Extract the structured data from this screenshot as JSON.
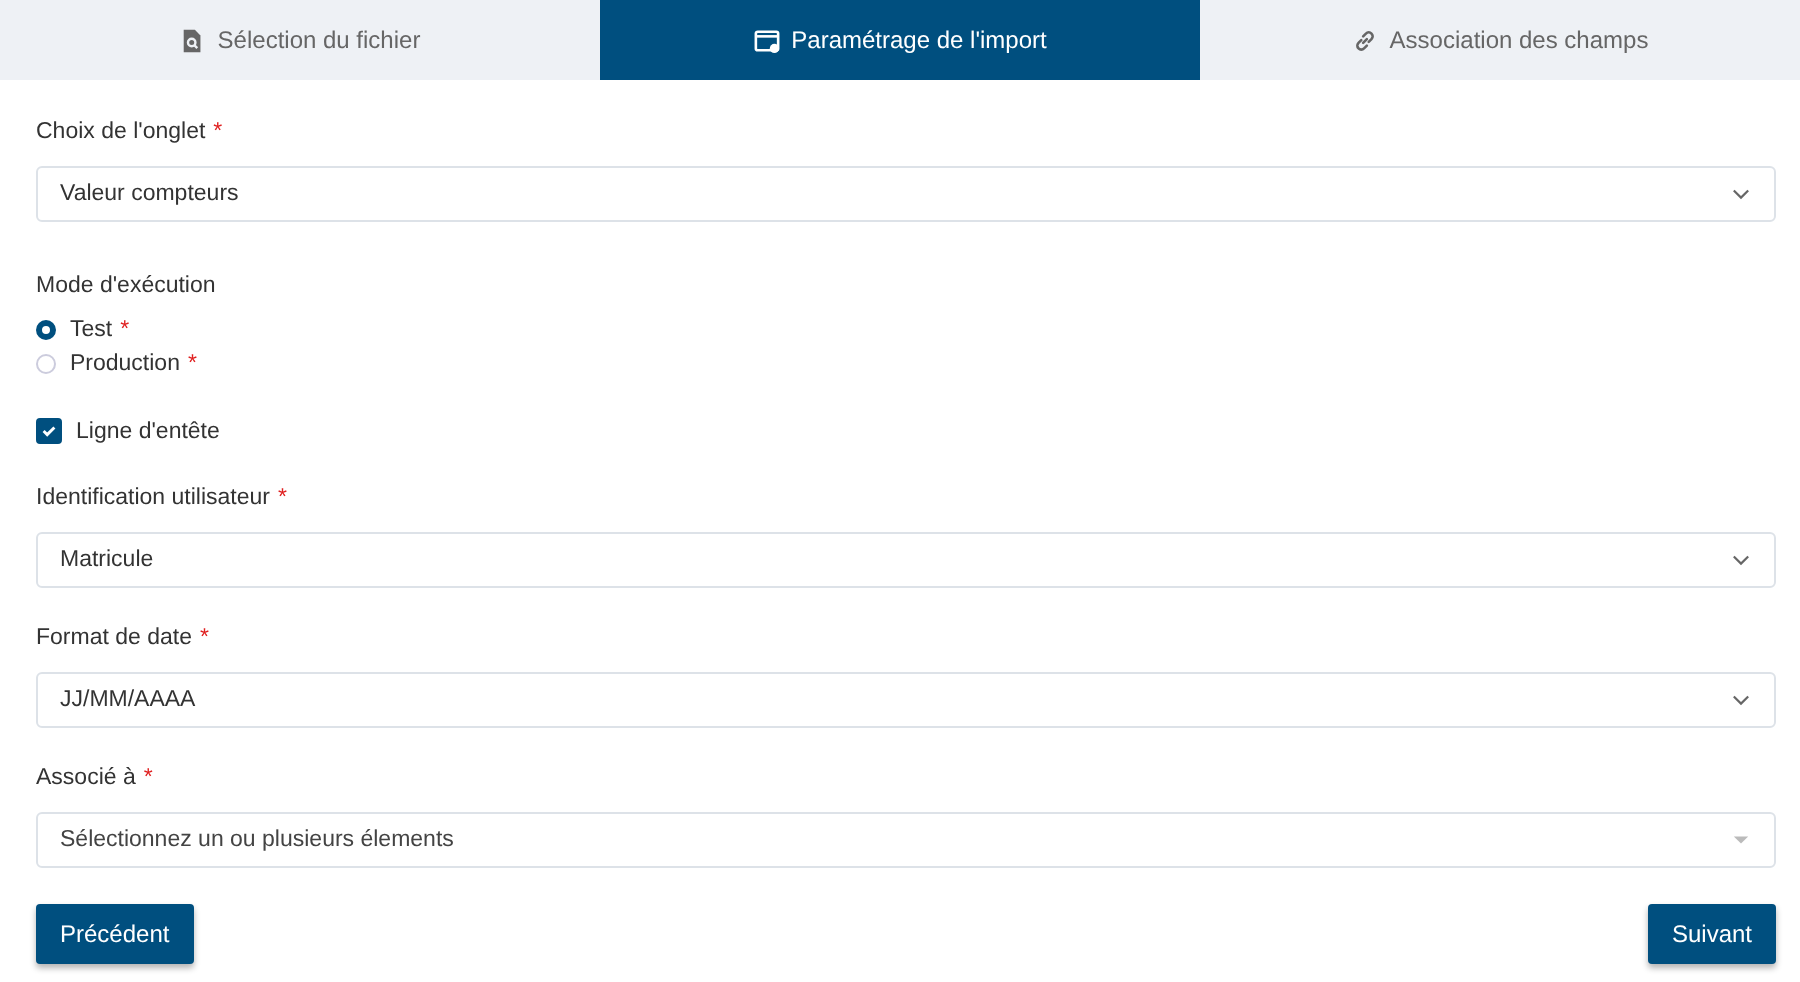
{
  "tabs": [
    {
      "label": "Sélection du fichier",
      "selected": false
    },
    {
      "label": "Paramétrage de l'import",
      "selected": true
    },
    {
      "label": "Association des champs",
      "selected": false
    }
  ],
  "form": [
    {
      "kind": "select",
      "label": "Choix de l'onglet",
      "required_mark": "*",
      "value": "Valeur compteurs"
    },
    {
      "kind": "radio-group",
      "label": "Mode d'exécution",
      "options": [
        {
          "label": "Test",
          "required_mark": "*",
          "selected": true
        },
        {
          "label": "Production",
          "required_mark": "*",
          "selected": false
        }
      ]
    },
    {
      "kind": "checkbox",
      "label": "Ligne d'entête",
      "checked": true
    },
    {
      "kind": "select",
      "label": "Identification utilisateur",
      "required_mark": "*",
      "value": "Matricule"
    },
    {
      "kind": "select",
      "label": "Format de date",
      "required_mark": "*",
      "value": "JJ/MM/AAAA"
    },
    {
      "kind": "multiselect",
      "label": "Associé à",
      "required_mark": "*",
      "placeholder": "Sélectionnez un ou plusieurs élements"
    }
  ],
  "buttons": [
    {
      "label": "Précédent"
    },
    {
      "label": "Suivant"
    }
  ]
}
